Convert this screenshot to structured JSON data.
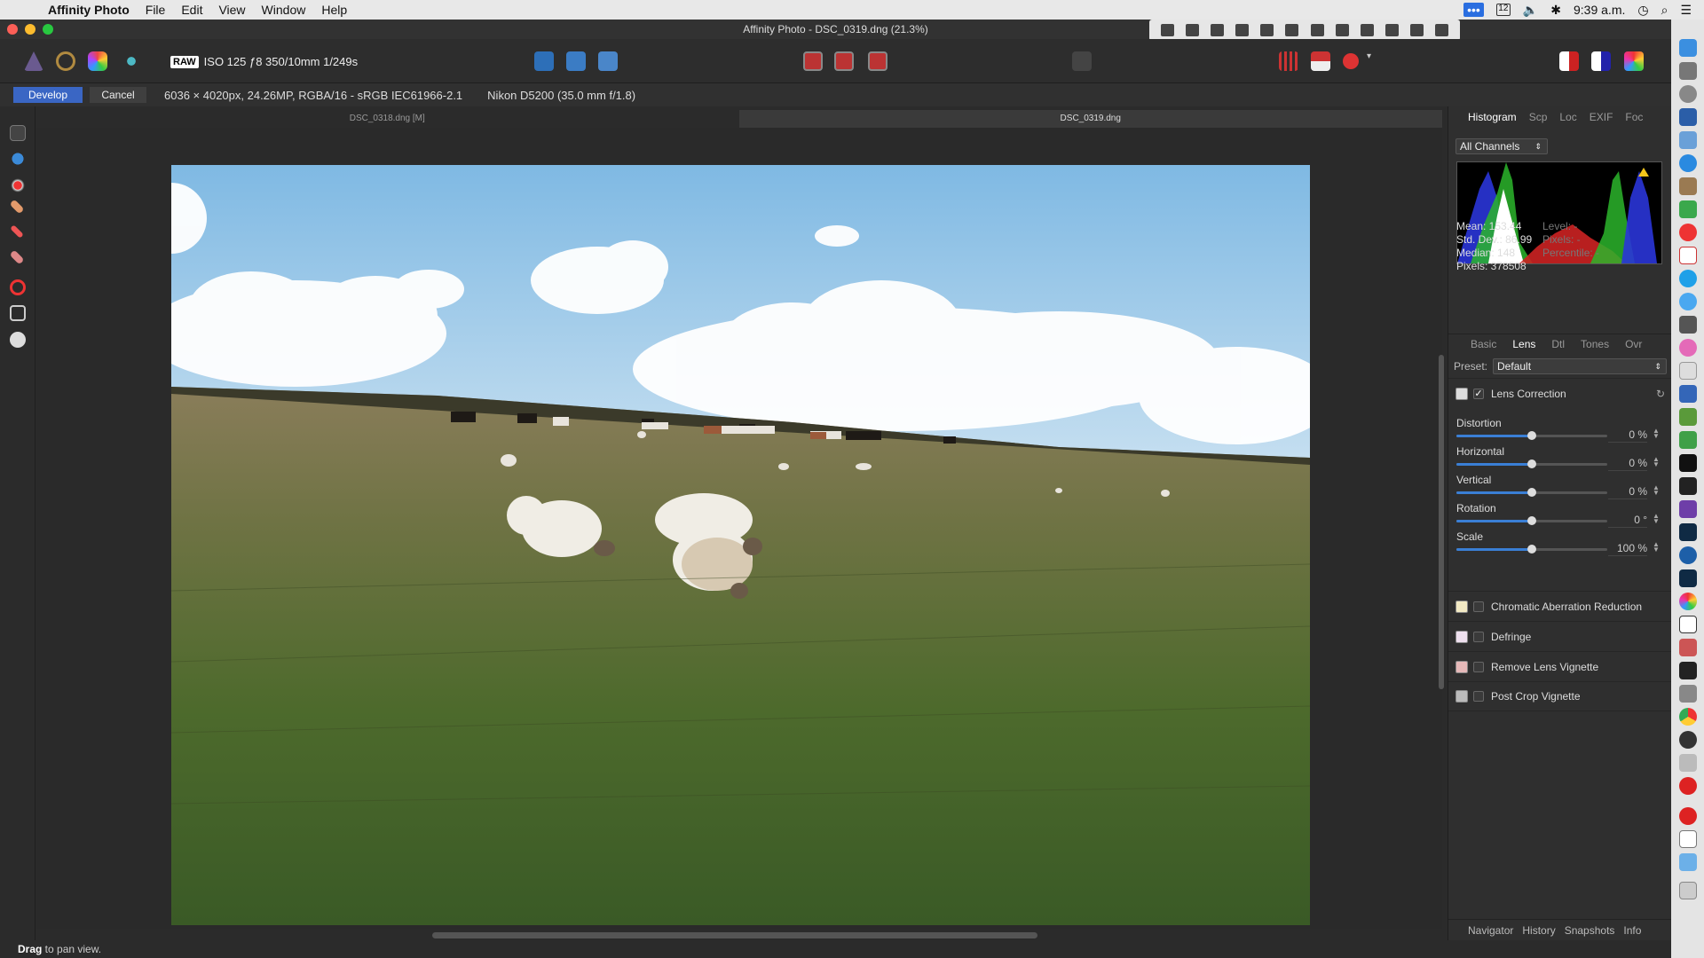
{
  "menubar": {
    "app": "Affinity Photo",
    "menus": [
      "File",
      "Edit",
      "View",
      "Window",
      "Help"
    ],
    "clock": "9:39 a.m.",
    "calendar_day": "12"
  },
  "window": {
    "title": "Affinity Photo - DSC_0319.dng (21.3%)"
  },
  "toolbar": {
    "raw_badge": "RAW",
    "exif": "ISO 125 ƒ8 350/10mm 1/249s"
  },
  "context": {
    "develop": "Develop",
    "cancel": "Cancel",
    "image_info": "6036 × 4020px, 24.26MP, RGBA/16 - sRGB IEC61966-2.1",
    "camera": "Nikon D5200 (35.0 mm f/1.8)"
  },
  "doc_tabs": [
    "DSC_0318.dng [M]",
    "DSC_0319.dng"
  ],
  "status": {
    "bold": "Drag",
    "rest": " to pan view."
  },
  "panel": {
    "top_tabs": [
      "Histogram",
      "Scp",
      "Loc",
      "EXIF",
      "Foc"
    ],
    "channels": "All Channels",
    "stats_left": [
      "Mean: 153.44",
      "Std. Dev.: 86.99",
      "Median: 148",
      "Pixels: 378508"
    ],
    "stats_right": [
      "Level: -",
      "Pixels: -",
      "Percentile: -"
    ],
    "dev_tabs": [
      "Basic",
      "Lens",
      "Dtl",
      "Tones",
      "Ovr"
    ],
    "preset_label": "Preset:",
    "preset_value": "Default",
    "lens_title": "Lens Correction",
    "sliders": [
      {
        "label": "Distortion",
        "value": "0 %",
        "pos": 0.5
      },
      {
        "label": "Horizontal",
        "value": "0 %",
        "pos": 0.5
      },
      {
        "label": "Vertical",
        "value": "0 %",
        "pos": 0.5
      },
      {
        "label": "Rotation",
        "value": "0 °",
        "pos": 0.5
      },
      {
        "label": "Scale",
        "value": "100 %",
        "pos": 0.5
      }
    ],
    "sections": [
      "Chromatic Aberration Reduction",
      "Defringe",
      "Remove Lens Vignette",
      "Post Crop Vignette"
    ],
    "bottom_tabs": [
      "Navigator",
      "History",
      "Snapshots",
      "Info"
    ]
  },
  "colors": {
    "accent": "#3a66c4",
    "slider": "#3a7fd5"
  }
}
